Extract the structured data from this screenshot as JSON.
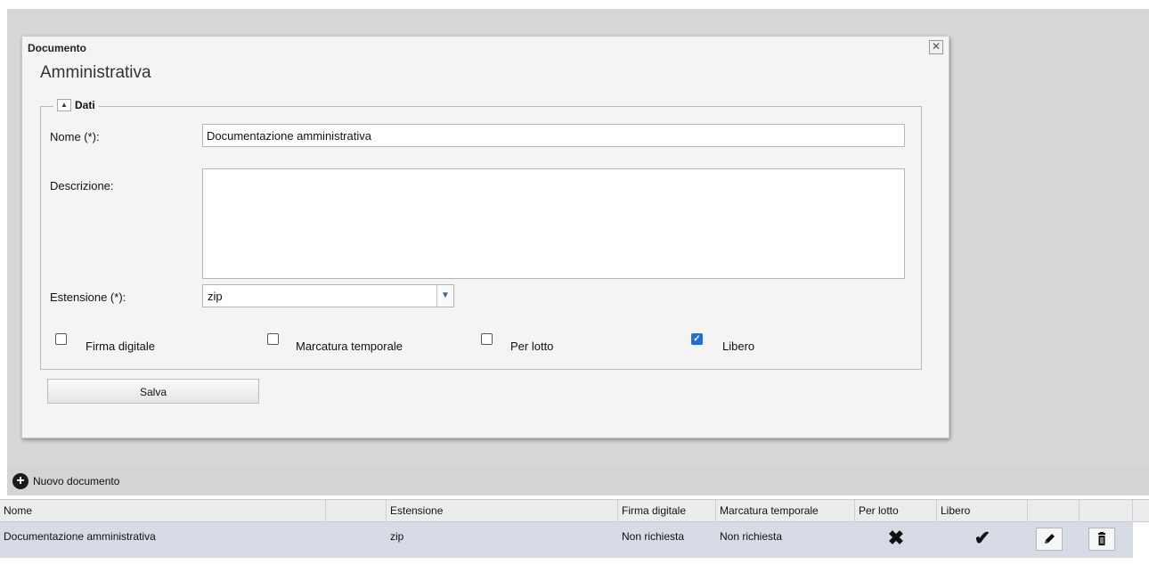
{
  "dialog": {
    "title": "Documento",
    "close_glyph": "✕",
    "heading": "Amministrativa",
    "fieldset": {
      "legend": "Dati",
      "toggle_glyph": "▲"
    },
    "fields": {
      "nome_label": "Nome (*):",
      "nome_value": "Documentazione amministrativa",
      "descrizione_label": "Descrizione:",
      "descrizione_value": "",
      "estensione_label": "Estensione (*):",
      "estensione_value": "zip",
      "select_arrow_glyph": "▼"
    },
    "checkboxes": [
      {
        "label": "Firma digitale",
        "checked": false
      },
      {
        "label": "Marcatura temporale",
        "checked": false
      },
      {
        "label": "Per lotto",
        "checked": false
      },
      {
        "label": "Libero",
        "checked": true
      }
    ],
    "checkmark_glyph": "✓",
    "save_label": "Salva"
  },
  "toolbar": {
    "new_document_label": "Nuovo documento",
    "plus_glyph": "+"
  },
  "grid": {
    "columns": [
      "Nome",
      "",
      "Estensione",
      "Firma digitale",
      "Marcatura temporale",
      "Per lotto",
      "Libero",
      "",
      ""
    ],
    "rows": [
      {
        "nome": "Documentazione amministrativa",
        "estensione": "zip",
        "firma_digitale": "Non richiesta",
        "marcatura_temporale": "Non richiesta",
        "per_lotto_icon": "✖",
        "libero_icon": "✔"
      }
    ]
  },
  "icons": {
    "close": "close-icon",
    "collapse": "collapse-up-icon",
    "dropdown": "chevron-down-icon",
    "add": "plus-circle-icon",
    "cross": "cross-icon",
    "check": "checkmark-icon",
    "edit": "pencil-icon",
    "delete": "trash-icon"
  },
  "colors": {
    "checkbox_checked": "#1f6fd4",
    "row_selected": "#d6dbe6",
    "dialog_bg": "#f4f4f4",
    "backdrop": "#d7d7d7"
  }
}
